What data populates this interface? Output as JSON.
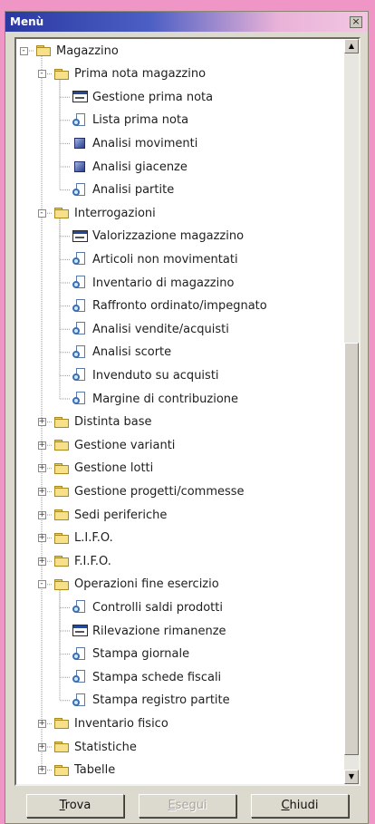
{
  "window": {
    "title": "Menù",
    "close_glyph": "×"
  },
  "tree": [
    {
      "label": "Magazzino",
      "icon": "folder",
      "level": 0,
      "toggle": "-"
    },
    {
      "label": "Prima nota magazzino",
      "icon": "folder",
      "level": 1,
      "toggle": "-"
    },
    {
      "label": "Gestione prima nota",
      "icon": "form",
      "level": 2
    },
    {
      "label": "Lista prima nota",
      "icon": "report",
      "level": 2
    },
    {
      "label": "Analisi movimenti",
      "icon": "cube",
      "level": 2
    },
    {
      "label": "Analisi giacenze",
      "icon": "cube",
      "level": 2
    },
    {
      "label": "Analisi partite",
      "icon": "report",
      "level": 2
    },
    {
      "label": "Interrogazioni",
      "icon": "folder",
      "level": 1,
      "toggle": "-"
    },
    {
      "label": "Valorizzazione magazzino",
      "icon": "form",
      "level": 2
    },
    {
      "label": "Articoli non movimentati",
      "icon": "report",
      "level": 2
    },
    {
      "label": "Inventario di magazzino",
      "icon": "report",
      "level": 2
    },
    {
      "label": "Raffronto ordinato/impegnato",
      "icon": "report",
      "level": 2
    },
    {
      "label": "Analisi vendite/acquisti",
      "icon": "report",
      "level": 2
    },
    {
      "label": "Analisi scorte",
      "icon": "report",
      "level": 2
    },
    {
      "label": "Invenduto su acquisti",
      "icon": "report",
      "level": 2
    },
    {
      "label": "Margine di contribuzione",
      "icon": "report",
      "level": 2
    },
    {
      "label": "Distinta base",
      "icon": "folder",
      "level": 1,
      "toggle": "+"
    },
    {
      "label": "Gestione varianti",
      "icon": "folder",
      "level": 1,
      "toggle": "+"
    },
    {
      "label": "Gestione lotti",
      "icon": "folder",
      "level": 1,
      "toggle": "+"
    },
    {
      "label": "Gestione progetti/commesse",
      "icon": "folder",
      "level": 1,
      "toggle": "+"
    },
    {
      "label": "Sedi periferiche",
      "icon": "folder",
      "level": 1,
      "toggle": "+"
    },
    {
      "label": "L.I.F.O.",
      "icon": "folder",
      "level": 1,
      "toggle": "+"
    },
    {
      "label": "F.I.F.O.",
      "icon": "folder",
      "level": 1,
      "toggle": "+"
    },
    {
      "label": "Operazioni fine esercizio",
      "icon": "folder",
      "level": 1,
      "toggle": "-"
    },
    {
      "label": "Controlli saldi prodotti",
      "icon": "report",
      "level": 2
    },
    {
      "label": "Rilevazione rimanenze",
      "icon": "form",
      "level": 2
    },
    {
      "label": "Stampa giornale",
      "icon": "report",
      "level": 2
    },
    {
      "label": "Stampa schede fiscali",
      "icon": "report",
      "level": 2
    },
    {
      "label": "Stampa registro partite",
      "icon": "report",
      "level": 2
    },
    {
      "label": "Inventario fisico",
      "icon": "folder",
      "level": 1,
      "toggle": "+"
    },
    {
      "label": "Statistiche",
      "icon": "folder",
      "level": 1,
      "toggle": "+"
    },
    {
      "label": "Tabelle",
      "icon": "folder",
      "level": 1,
      "toggle": "+"
    }
  ],
  "scrollbar": {
    "up_glyph": "▲",
    "down_glyph": "▼"
  },
  "buttons": {
    "find": {
      "mnemonic": "T",
      "rest": "rova"
    },
    "run": {
      "mnemonic": "E",
      "rest": "segui"
    },
    "close": {
      "mnemonic": "C",
      "rest": "hiudi"
    }
  },
  "colors": {
    "background": "#ef96c6",
    "titlebar_start": "#2a39a2",
    "window": "#dcd9ce"
  }
}
